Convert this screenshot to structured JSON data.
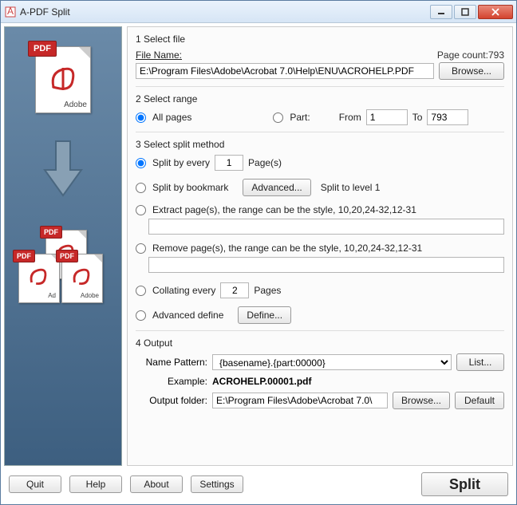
{
  "window": {
    "title": "A-PDF Split"
  },
  "section1": {
    "title": "1 Select file",
    "filename_label": "File Name:",
    "filename_value": "E:\\Program Files\\Adobe\\Acrobat 7.0\\Help\\ENU\\ACROHELP.PDF",
    "page_count_label": "Page count:",
    "page_count_value": "793",
    "browse": "Browse..."
  },
  "section2": {
    "title": "2 Select range",
    "all_pages": "All pages",
    "part": "Part:",
    "from": "From",
    "from_value": "1",
    "to": "To",
    "to_value": "793"
  },
  "section3": {
    "title": "3 Select split method",
    "split_every": "Split by every",
    "split_every_value": "1",
    "pages_label": "Page(s)",
    "split_bookmark": "Split by bookmark",
    "advanced": "Advanced...",
    "split_level": "Split to level 1",
    "extract": "Extract page(s), the range can be the style, 10,20,24-32,12-31",
    "remove": "Remove page(s), the range can be the style, 10,20,24-32,12-31",
    "collating": "Collating every",
    "collating_value": "2",
    "pages_label2": "Pages",
    "adv_define": "Advanced define",
    "define": "Define..."
  },
  "section4": {
    "title": "4 Output",
    "name_pattern_label": "Name Pattern:",
    "name_pattern_value": "{basename}.{part:00000}",
    "list": "List...",
    "example_label": "Example:",
    "example_value": "ACROHELP.00001.pdf",
    "output_folder_label": "Output folder:",
    "output_folder_value": "E:\\Program Files\\Adobe\\Acrobat 7.0\\",
    "browse": "Browse...",
    "default": "Default"
  },
  "footer": {
    "quit": "Quit",
    "help": "Help",
    "about": "About",
    "settings": "Settings",
    "split": "Split"
  }
}
